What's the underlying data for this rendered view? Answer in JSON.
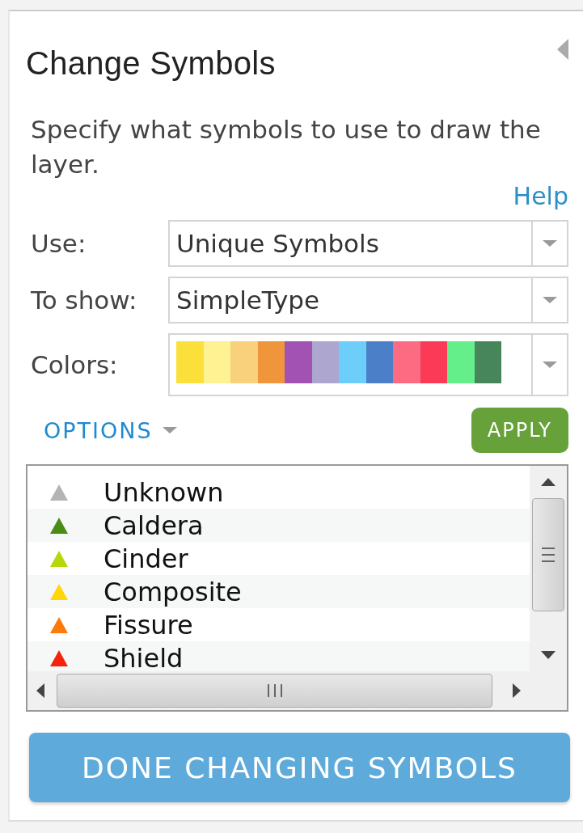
{
  "panel": {
    "title": "Change Symbols",
    "description": "Specify what symbols to use to draw the layer.",
    "help_link": "Help"
  },
  "fields": [
    {
      "kind": "select",
      "label": "Use:",
      "value": "Unique Symbols"
    },
    {
      "kind": "select",
      "label": "To show:",
      "value": "SimpleType"
    },
    {
      "kind": "ramp",
      "label": "Colors:",
      "swatches": [
        {
          "color": "#fbe03c"
        },
        {
          "color": "#fef293"
        },
        {
          "color": "#f9d07c"
        },
        {
          "color": "#ef963c"
        },
        {
          "color": "#a152b3"
        },
        {
          "color": "#ada6cf"
        },
        {
          "color": "#6ccef9"
        },
        {
          "color": "#4b7fc8"
        },
        {
          "color": "#fc6b81"
        },
        {
          "color": "#fb3a58"
        },
        {
          "color": "#65ef8a"
        },
        {
          "color": "#47855b"
        }
      ]
    }
  ],
  "options_link": "OPTIONS",
  "apply_button": "APPLY",
  "symbols": [
    {
      "label": "Unknown",
      "color": "#b4b4b4"
    },
    {
      "label": "Caldera",
      "color": "#4a8c16"
    },
    {
      "label": "Cinder",
      "color": "#b5d80b"
    },
    {
      "label": "Composite",
      "color": "#ffd60a"
    },
    {
      "label": "Fissure",
      "color": "#ff7a0a"
    },
    {
      "label": "Shield",
      "color": "#f7220c"
    }
  ],
  "done_button": "DONE CHANGING SYMBOLS"
}
